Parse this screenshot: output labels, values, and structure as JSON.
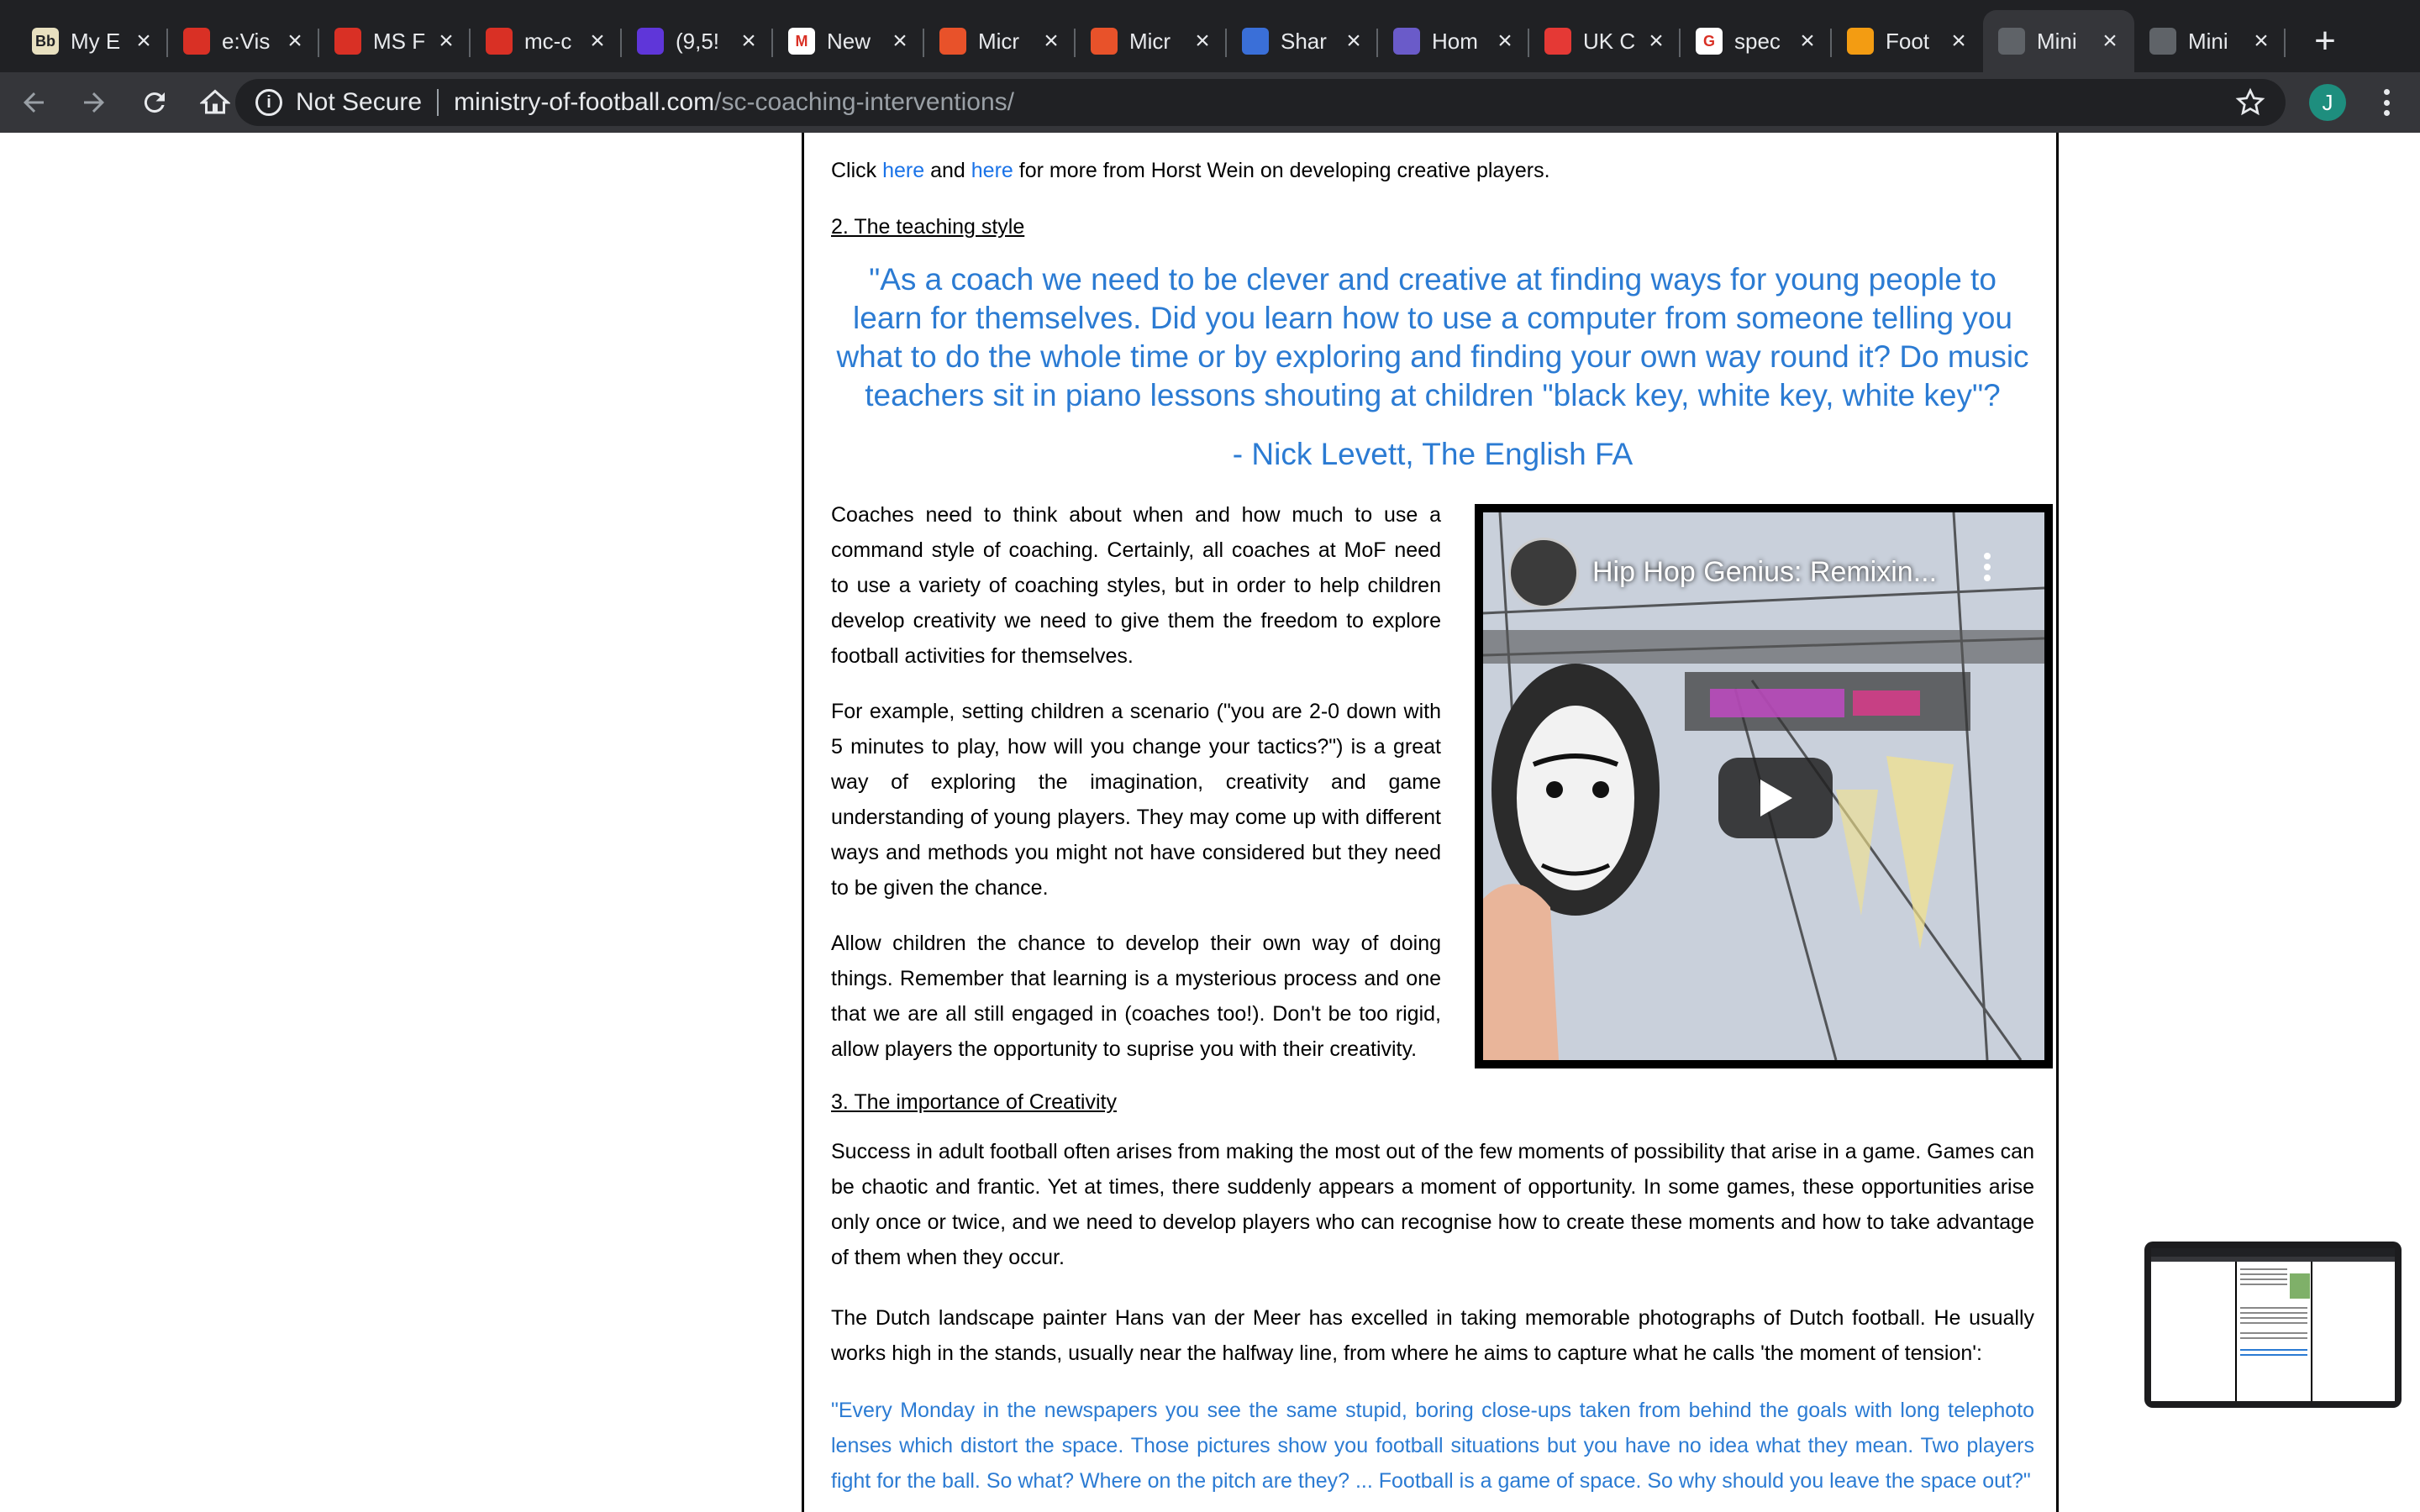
{
  "tabs": [
    {
      "title": "My E",
      "fav_text": "Bb",
      "fav_color": "#e8e0c0"
    },
    {
      "title": "e:Vis",
      "fav_text": "",
      "fav_color": "#d93025"
    },
    {
      "title": "MS F",
      "fav_text": "",
      "fav_color": "#d93025"
    },
    {
      "title": "mc-c",
      "fav_text": "",
      "fav_color": "#d93025"
    },
    {
      "title": "(9,5!",
      "fav_text": "",
      "fav_color": "#5f36d9"
    },
    {
      "title": "New",
      "fav_text": "M",
      "fav_color": "#ffffff"
    },
    {
      "title": "Micr",
      "fav_text": "",
      "fav_color": "#e8522a"
    },
    {
      "title": "Micr",
      "fav_text": "",
      "fav_color": "#e8522a"
    },
    {
      "title": "Shar",
      "fav_text": "",
      "fav_color": "#3a6fd8"
    },
    {
      "title": "Hom",
      "fav_text": "",
      "fav_color": "#6a5bc9"
    },
    {
      "title": "UK C",
      "fav_text": "",
      "fav_color": "#e53935"
    },
    {
      "title": "spec",
      "fav_text": "G",
      "fav_color": "#ffffff"
    },
    {
      "title": "Foot",
      "fav_text": "",
      "fav_color": "#f39c12"
    },
    {
      "title": "Mini",
      "fav_text": "",
      "fav_color": "#5f6368",
      "active": true
    },
    {
      "title": "Mini",
      "fav_text": "",
      "fav_color": "#5f6368"
    }
  ],
  "address_bar": {
    "security_label": "Not Secure",
    "url_host": "ministry-of-football.com",
    "url_path": "/sc-coaching-interventions/"
  },
  "profile_initial": "J",
  "article": {
    "intro": {
      "pre": "Click ",
      "link1": "here",
      "mid": " and ",
      "link2": "here",
      "post": " for more from Horst Wein on developing creative players."
    },
    "heading2": "2. The teaching style",
    "quote1": "\"As a coach we need to be clever and creative at finding ways for young people to learn for themselves. Did you learn how to use a computer from someone telling you what to do the whole time or by exploring and finding your own way round it? Do music teachers sit in piano lessons shouting at children \"black key, white key, white key\"?",
    "quote1_attribution": "- Nick Levett, The English FA",
    "para1": "Coaches need to think about when and how much to use a command style of coaching. Certainly, all coaches at MoF need to use a variety of coaching styles, but in order to help children develop creativity we need to give them the freedom to explore football activities for themselves.",
    "para2": "For example, setting children a scenario (\"you are 2-0 down with 5 minutes to play, how will you change your tactics?\") is a great way of exploring the imagination, creativity and game understanding of young players. They may come up with different ways and methods you might not have considered but they need to be given the chance.",
    "para3": "Allow children the chance to develop their own way of doing things. Remember that learning is a mysterious process and one that we are all still engaged in (coaches too!). Don't be too rigid, allow players the opportunity to suprise you with their creativity.",
    "heading3": "3. The importance of Creativity",
    "para4": "Success in adult football often arises from making the most out of the few moments of possibility that arise in a game. Games can be chaotic and frantic. Yet at times, there suddenly appears a moment of opportunity. In some games, these opportunities arise only once or twice, and we need to develop players who can recognise how to create these moments and how to take advantage of them when they occur.",
    "para5": "The Dutch landscape painter Hans van der Meer has excelled in taking memorable photographs of Dutch football. He usually works high in the stands, usually near the halfway line, from where he aims to capture what he calls 'the moment of tension':",
    "quote2": "\"Every Monday in the newspapers you see the same stupid, boring close-ups taken from behind the goals with long telephoto lenses which distort the space. Those pictures show you football situations but you have no idea what they mean. Two players fight for the ball. So what? Where on the pitch are they? ... Football is a game of space. So why should you leave the space out?\""
  },
  "video": {
    "title": "Hip Hop Genius: Remixin..."
  },
  "colors": {
    "link": "#1a73e8",
    "quote": "#2b7bd3",
    "chrome_dark": "#202124",
    "chrome_toolbar": "#35363a"
  }
}
